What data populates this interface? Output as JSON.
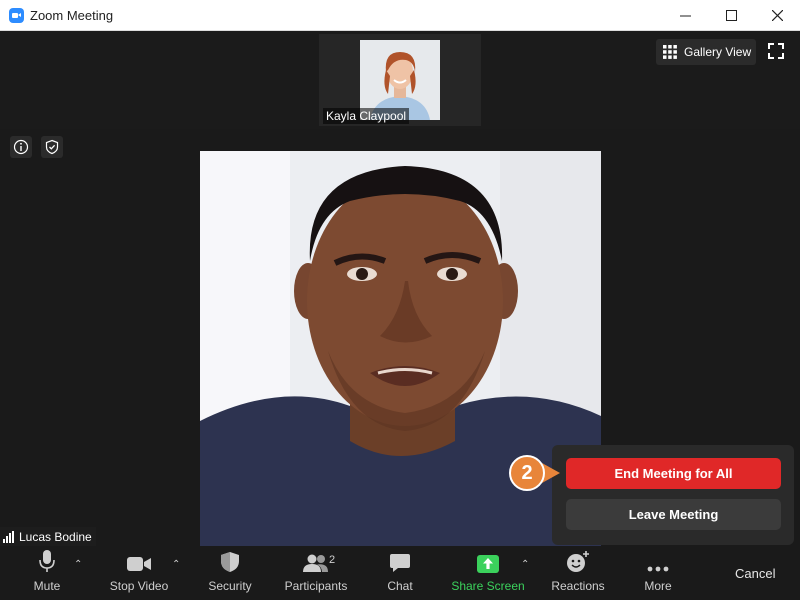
{
  "window": {
    "title": "Zoom Meeting"
  },
  "top_controls": {
    "gallery_view_label": "Gallery View"
  },
  "participants": {
    "thumbnail_name": "Kayla Claypool",
    "speaker_name": "Lucas Bodine"
  },
  "popover": {
    "end_for_all_label": "End Meeting for All",
    "leave_label": "Leave Meeting",
    "step_number": "2"
  },
  "toolbar": {
    "mute_label": "Mute",
    "stop_video_label": "Stop Video",
    "security_label": "Security",
    "participants_label": "Participants",
    "participants_count": "2",
    "chat_label": "Chat",
    "share_screen_label": "Share Screen",
    "reactions_label": "Reactions",
    "more_label": "More",
    "cancel_label": "Cancel"
  },
  "colors": {
    "end_button": "#e02828",
    "share_screen": "#3bd15c",
    "step_badge": "#e8853a",
    "zoom_blue": "#2d8cff"
  },
  "icons": {
    "app": "zoom-camera-icon",
    "gallery": "grid-icon",
    "fullscreen": "fullscreen-icon",
    "info": "info-icon",
    "shield": "shield-check-icon",
    "mute": "microphone-icon",
    "video": "video-camera-icon",
    "security": "shield-icon",
    "participants": "people-icon",
    "chat": "chat-bubble-icon",
    "share": "share-arrow-icon",
    "reactions": "smiley-add-icon",
    "more": "ellipsis-icon"
  }
}
